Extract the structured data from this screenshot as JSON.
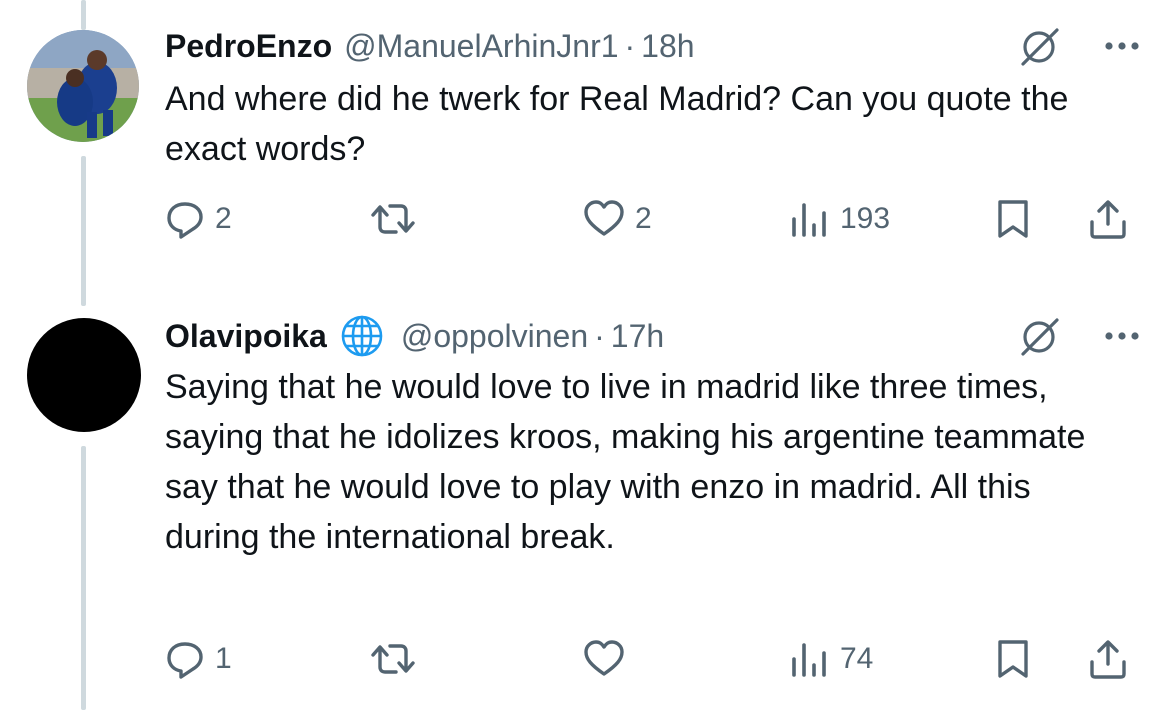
{
  "tweets": [
    {
      "display_name": "PedroEnzo",
      "handle": "@ManuelArhinJnr1",
      "separator": "·",
      "time": "18h",
      "text": "And where did he twerk for Real Madrid? Can you quote the exact words?",
      "actions": {
        "replies": "2",
        "reposts": "",
        "likes": "2",
        "views": "193"
      },
      "icons": {
        "grok": "grok-icon",
        "more": "more-icon",
        "reply": "reply-icon",
        "repost": "repost-icon",
        "like": "heart-icon",
        "views": "views-icon",
        "bookmark": "bookmark-icon",
        "share": "share-icon"
      }
    },
    {
      "display_name": "Olavipoika",
      "handle": "@oppolvinen",
      "separator": "·",
      "time": "17h",
      "text": "Saying that he would love to live in madrid like three times, saying that he idolizes kroos, making his argentine teammate say that he would love to play with enzo in madrid. All this during the international break.",
      "actions": {
        "replies": "1",
        "reposts": "",
        "likes": "",
        "views": "74"
      },
      "icons": {
        "badge": "globe-icon",
        "grok": "grok-icon",
        "more": "more-icon",
        "reply": "reply-icon",
        "repost": "repost-icon",
        "like": "heart-icon",
        "views": "views-icon",
        "bookmark": "bookmark-icon",
        "share": "share-icon"
      }
    }
  ],
  "colors": {
    "text": "#0f1419",
    "secondary": "#536471",
    "thread_line": "#cfd9de",
    "badge": "#1d9bf0"
  }
}
